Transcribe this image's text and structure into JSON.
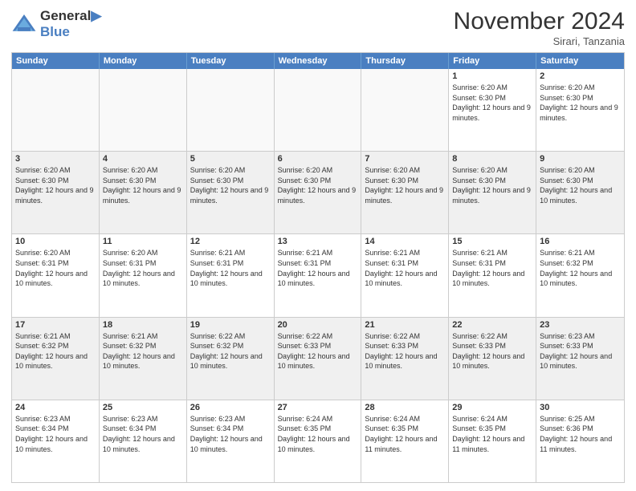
{
  "logo": {
    "line1": "General",
    "line2": "Blue"
  },
  "title": "November 2024",
  "location": "Sirari, Tanzania",
  "days_of_week": [
    "Sunday",
    "Monday",
    "Tuesday",
    "Wednesday",
    "Thursday",
    "Friday",
    "Saturday"
  ],
  "weeks": [
    [
      {
        "day": "",
        "empty": true
      },
      {
        "day": "",
        "empty": true
      },
      {
        "day": "",
        "empty": true
      },
      {
        "day": "",
        "empty": true
      },
      {
        "day": "",
        "empty": true
      },
      {
        "day": "1",
        "sunrise": "6:20 AM",
        "sunset": "6:30 PM",
        "daylight": "12 hours and 9 minutes."
      },
      {
        "day": "2",
        "sunrise": "6:20 AM",
        "sunset": "6:30 PM",
        "daylight": "12 hours and 9 minutes."
      }
    ],
    [
      {
        "day": "3",
        "sunrise": "6:20 AM",
        "sunset": "6:30 PM",
        "daylight": "12 hours and 9 minutes.",
        "shaded": true
      },
      {
        "day": "4",
        "sunrise": "6:20 AM",
        "sunset": "6:30 PM",
        "daylight": "12 hours and 9 minutes.",
        "shaded": true
      },
      {
        "day": "5",
        "sunrise": "6:20 AM",
        "sunset": "6:30 PM",
        "daylight": "12 hours and 9 minutes.",
        "shaded": true
      },
      {
        "day": "6",
        "sunrise": "6:20 AM",
        "sunset": "6:30 PM",
        "daylight": "12 hours and 9 minutes.",
        "shaded": true
      },
      {
        "day": "7",
        "sunrise": "6:20 AM",
        "sunset": "6:30 PM",
        "daylight": "12 hours and 9 minutes.",
        "shaded": true
      },
      {
        "day": "8",
        "sunrise": "6:20 AM",
        "sunset": "6:30 PM",
        "daylight": "12 hours and 9 minutes.",
        "shaded": true
      },
      {
        "day": "9",
        "sunrise": "6:20 AM",
        "sunset": "6:30 PM",
        "daylight": "12 hours and 10 minutes.",
        "shaded": true
      }
    ],
    [
      {
        "day": "10",
        "sunrise": "6:20 AM",
        "sunset": "6:31 PM",
        "daylight": "12 hours and 10 minutes."
      },
      {
        "day": "11",
        "sunrise": "6:20 AM",
        "sunset": "6:31 PM",
        "daylight": "12 hours and 10 minutes."
      },
      {
        "day": "12",
        "sunrise": "6:21 AM",
        "sunset": "6:31 PM",
        "daylight": "12 hours and 10 minutes."
      },
      {
        "day": "13",
        "sunrise": "6:21 AM",
        "sunset": "6:31 PM",
        "daylight": "12 hours and 10 minutes."
      },
      {
        "day": "14",
        "sunrise": "6:21 AM",
        "sunset": "6:31 PM",
        "daylight": "12 hours and 10 minutes."
      },
      {
        "day": "15",
        "sunrise": "6:21 AM",
        "sunset": "6:31 PM",
        "daylight": "12 hours and 10 minutes."
      },
      {
        "day": "16",
        "sunrise": "6:21 AM",
        "sunset": "6:32 PM",
        "daylight": "12 hours and 10 minutes."
      }
    ],
    [
      {
        "day": "17",
        "sunrise": "6:21 AM",
        "sunset": "6:32 PM",
        "daylight": "12 hours and 10 minutes.",
        "shaded": true
      },
      {
        "day": "18",
        "sunrise": "6:21 AM",
        "sunset": "6:32 PM",
        "daylight": "12 hours and 10 minutes.",
        "shaded": true
      },
      {
        "day": "19",
        "sunrise": "6:22 AM",
        "sunset": "6:32 PM",
        "daylight": "12 hours and 10 minutes.",
        "shaded": true
      },
      {
        "day": "20",
        "sunrise": "6:22 AM",
        "sunset": "6:33 PM",
        "daylight": "12 hours and 10 minutes.",
        "shaded": true
      },
      {
        "day": "21",
        "sunrise": "6:22 AM",
        "sunset": "6:33 PM",
        "daylight": "12 hours and 10 minutes.",
        "shaded": true
      },
      {
        "day": "22",
        "sunrise": "6:22 AM",
        "sunset": "6:33 PM",
        "daylight": "12 hours and 10 minutes.",
        "shaded": true
      },
      {
        "day": "23",
        "sunrise": "6:23 AM",
        "sunset": "6:33 PM",
        "daylight": "12 hours and 10 minutes.",
        "shaded": true
      }
    ],
    [
      {
        "day": "24",
        "sunrise": "6:23 AM",
        "sunset": "6:34 PM",
        "daylight": "12 hours and 10 minutes."
      },
      {
        "day": "25",
        "sunrise": "6:23 AM",
        "sunset": "6:34 PM",
        "daylight": "12 hours and 10 minutes."
      },
      {
        "day": "26",
        "sunrise": "6:23 AM",
        "sunset": "6:34 PM",
        "daylight": "12 hours and 10 minutes."
      },
      {
        "day": "27",
        "sunrise": "6:24 AM",
        "sunset": "6:35 PM",
        "daylight": "12 hours and 10 minutes."
      },
      {
        "day": "28",
        "sunrise": "6:24 AM",
        "sunset": "6:35 PM",
        "daylight": "12 hours and 11 minutes."
      },
      {
        "day": "29",
        "sunrise": "6:24 AM",
        "sunset": "6:35 PM",
        "daylight": "12 hours and 11 minutes."
      },
      {
        "day": "30",
        "sunrise": "6:25 AM",
        "sunset": "6:36 PM",
        "daylight": "12 hours and 11 minutes."
      }
    ]
  ]
}
